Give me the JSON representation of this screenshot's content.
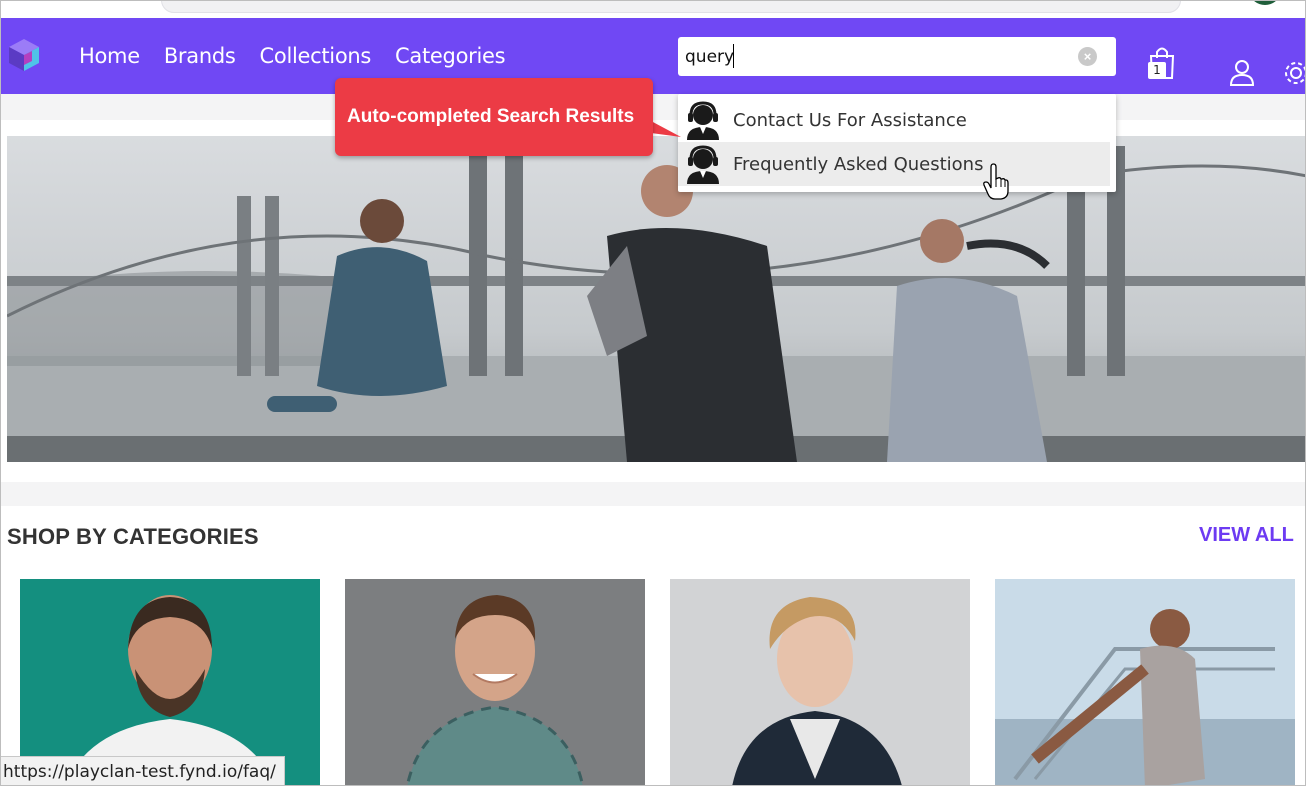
{
  "colors": {
    "header_bg": "#7048f4",
    "callout_bg": "#ec3b45",
    "view_all": "#6d3bf2"
  },
  "nav": {
    "items": [
      {
        "label": "Home"
      },
      {
        "label": "Brands"
      },
      {
        "label": "Collections"
      },
      {
        "label": "Categories"
      }
    ]
  },
  "search": {
    "value": "query",
    "clear_icon": "clear-icon"
  },
  "cart": {
    "icon": "shopping-bag-icon",
    "count": "1"
  },
  "account": {
    "icon": "user-icon"
  },
  "settings": {
    "icon": "gear-icon"
  },
  "autocomplete": {
    "items": [
      {
        "label": "Contact Us For Assistance",
        "icon": "support-agent-icon"
      },
      {
        "label": "Frequently Asked Questions",
        "icon": "support-agent-icon"
      }
    ]
  },
  "callout": {
    "text": "Auto-completed Search Results"
  },
  "categories": {
    "title": "SHOP BY CATEGORIES",
    "view_all": "VIEW ALL"
  },
  "status_bar": {
    "url": "https://playclan-test.fynd.io/faq/"
  }
}
